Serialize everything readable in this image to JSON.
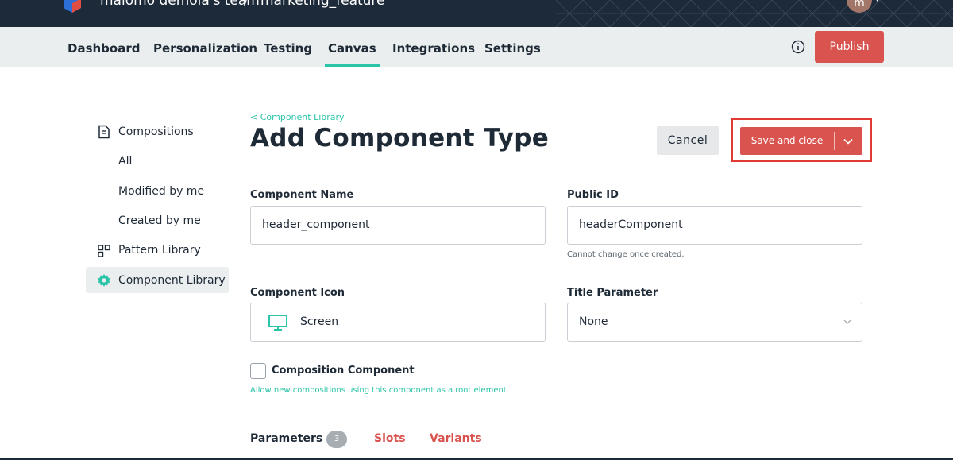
{
  "topbar": {
    "team": "malomo demola's team",
    "separator": "/",
    "project": "marketing_feature",
    "avatar_initial": "m"
  },
  "nav": {
    "items": [
      {
        "label": "Dashboard"
      },
      {
        "label": "Personalization"
      },
      {
        "label": "Testing"
      },
      {
        "label": "Canvas"
      },
      {
        "label": "Integrations"
      },
      {
        "label": "Settings"
      }
    ],
    "active": "Canvas",
    "publish_label": "Publish"
  },
  "sidebar": {
    "compositions": "Compositions",
    "all": "All",
    "modified_by_me": "Modified by me",
    "created_by_me": "Created by me",
    "pattern_library": "Pattern Library",
    "component_library": "Component Library"
  },
  "header": {
    "breadcrumb": "< Component Library",
    "title": "Add Component Type",
    "cancel_label": "Cancel",
    "save_label": "Save and close"
  },
  "form": {
    "component_name_label": "Component Name",
    "component_name_value": "header_component",
    "public_id_label": "Public ID",
    "public_id_value": "headerComponent",
    "public_id_help": "Cannot change once created.",
    "component_icon_label": "Component Icon",
    "component_icon_value": "Screen",
    "title_parameter_label": "Title Parameter",
    "title_parameter_value": "None",
    "composition_label": "Composition Component",
    "composition_checked": false,
    "composition_help": "Allow new compositions using this component as a root element"
  },
  "tabs": {
    "parameters": "Parameters",
    "parameters_count": "3",
    "slots": "Slots",
    "variants": "Variants"
  },
  "colors": {
    "accent": "#2bc4a8",
    "primary_button": "#d9534f",
    "highlight_border": "#e03b33",
    "topbar": "#1d2a3a"
  }
}
